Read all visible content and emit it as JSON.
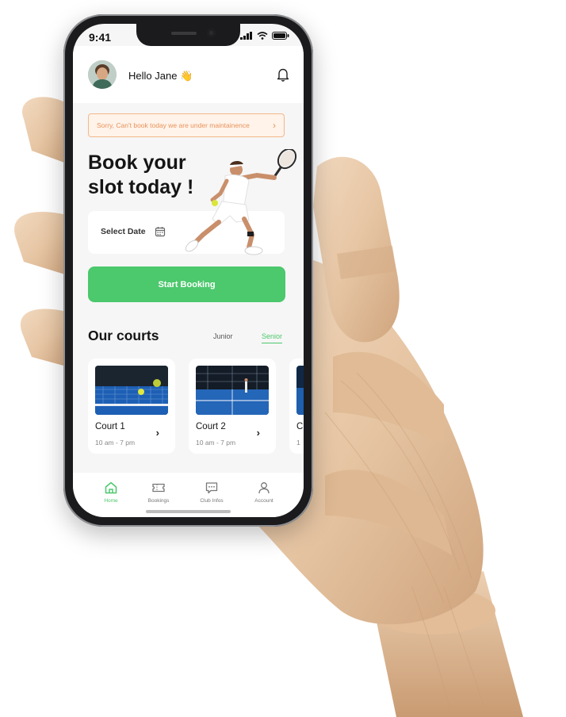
{
  "status_bar": {
    "time": "9:41"
  },
  "header": {
    "greeting": "Hello Jane 👋"
  },
  "banner": {
    "message": "Sorry, Can't book today we are under maintainence",
    "chevron": "›"
  },
  "hero": {
    "title": "Book your\nslot today !",
    "date_label": "Select Date",
    "cta_label": "Start Booking"
  },
  "courts": {
    "title": "Our courts",
    "tabs": [
      {
        "label": "Junior",
        "active": false
      },
      {
        "label": "Senior",
        "active": true
      }
    ],
    "items": [
      {
        "name": "Court 1",
        "hours": "10 am - 7 pm"
      },
      {
        "name": "Court 2",
        "hours": "10 am - 7 pm"
      },
      {
        "name": "C",
        "hours": "1"
      }
    ]
  },
  "nav": {
    "items": [
      {
        "label": "Home",
        "icon": "home-icon",
        "active": true
      },
      {
        "label": "Bookings",
        "icon": "ticket-icon",
        "active": false
      },
      {
        "label": "Club Infos",
        "icon": "chat-icon",
        "active": false
      },
      {
        "label": "Account",
        "icon": "user-icon",
        "active": false
      }
    ]
  },
  "colors": {
    "accent": "#4cc86d",
    "banner_text": "#e8935a",
    "banner_border": "#f3b789"
  }
}
